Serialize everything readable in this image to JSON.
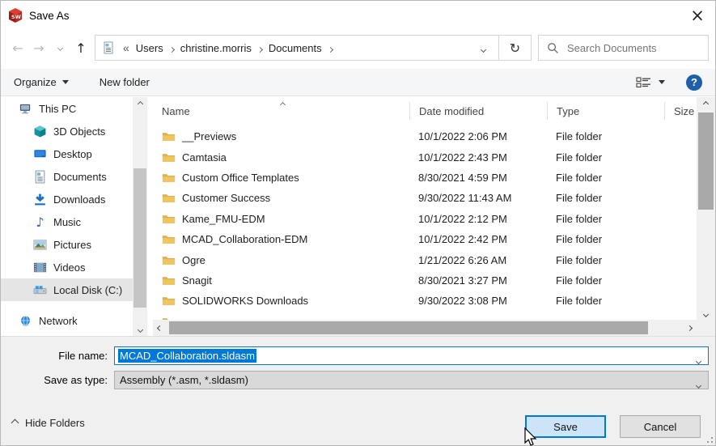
{
  "window": {
    "title": "Save As"
  },
  "nav": {
    "breadcrumb_prefix": "«",
    "crumbs": [
      {
        "label": "Users"
      },
      {
        "label": "christine.morris"
      },
      {
        "label": "Documents"
      }
    ],
    "search_placeholder": "Search Documents"
  },
  "toolbar": {
    "organize": "Organize",
    "new_folder": "New folder",
    "help": "?"
  },
  "sidebar": {
    "items": [
      {
        "label": "This PC"
      },
      {
        "label": "3D Objects"
      },
      {
        "label": "Desktop"
      },
      {
        "label": "Documents"
      },
      {
        "label": "Downloads"
      },
      {
        "label": "Music"
      },
      {
        "label": "Pictures"
      },
      {
        "label": "Videos"
      },
      {
        "label": "Local Disk (C:)"
      },
      {
        "label": "Network"
      }
    ],
    "selected_item": "Local Disk (C:)"
  },
  "list": {
    "columns": {
      "name": "Name",
      "date": "Date modified",
      "type": "Type",
      "size": "Size"
    },
    "files": [
      {
        "name": "__Previews",
        "date": "10/1/2022 2:06 PM",
        "type": "File folder"
      },
      {
        "name": "Camtasia",
        "date": "10/1/2022 2:43 PM",
        "type": "File folder"
      },
      {
        "name": "Custom Office Templates",
        "date": "8/30/2021 4:59 PM",
        "type": "File folder"
      },
      {
        "name": "Customer Success",
        "date": "9/30/2022 11:43 AM",
        "type": "File folder"
      },
      {
        "name": "Kame_FMU-EDM",
        "date": "10/1/2022 2:12 PM",
        "type": "File folder"
      },
      {
        "name": "MCAD_Collaboration-EDM",
        "date": "10/1/2022 2:42 PM",
        "type": "File folder"
      },
      {
        "name": "Ogre",
        "date": "1/21/2022 6:26 AM",
        "type": "File folder"
      },
      {
        "name": "Snagit",
        "date": "8/30/2021 3:27 PM",
        "type": "File folder"
      },
      {
        "name": "SOLIDWORKS Downloads",
        "date": "9/30/2022 3:08 PM",
        "type": "File folder"
      }
    ]
  },
  "fields": {
    "file_name_label": "File name:",
    "file_name_value": "MCAD_Collaboration.sldasm",
    "save_as_type_label": "Save as type:",
    "save_as_type_value": "Assembly (*.asm, *.sldasm)"
  },
  "footer": {
    "hide_folders": "Hide Folders",
    "save": "Save",
    "cancel": "Cancel"
  },
  "icons": {
    "app_label": "SW",
    "close": "×",
    "back": "←",
    "forward": "→",
    "up": "↑",
    "refresh": "↻",
    "music": "♪"
  },
  "colors": {
    "accent": "#0078d7",
    "selection": "#0078d7",
    "save_button_bg": "#cce4f7",
    "folder": "#efc55f",
    "toolbar_bg": "#f5f6f7",
    "footer_bg": "#f0f0f0"
  }
}
